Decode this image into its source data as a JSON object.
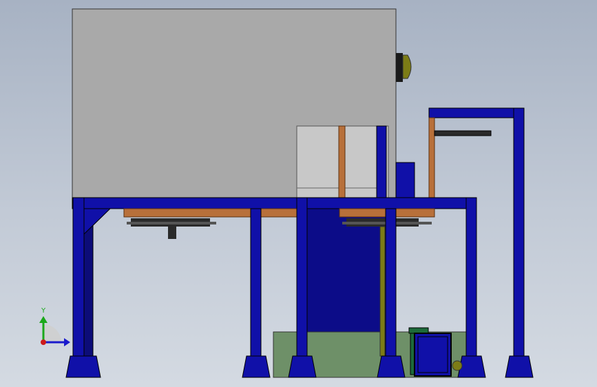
{
  "viewport": {
    "background_top": "#a7b2c3",
    "background_bottom": "#d4dae2"
  },
  "model": {
    "frame_color": "#1010a8",
    "frame_shade": "#0c0c78",
    "hopper_color": "#a9a9a9",
    "cabinet_color": "#c8c8c8",
    "copper_color": "#b8703a",
    "tank_color": "#6e9068",
    "motor_color": "#7c7c16",
    "pump_color": "#1d6a3a",
    "slide_color": "#2a2a2a"
  },
  "triad": {
    "y_label": "Y",
    "y_color": "#1aa81a",
    "x_color": "#1a1acc",
    "z_color": "#cc1a1a"
  }
}
